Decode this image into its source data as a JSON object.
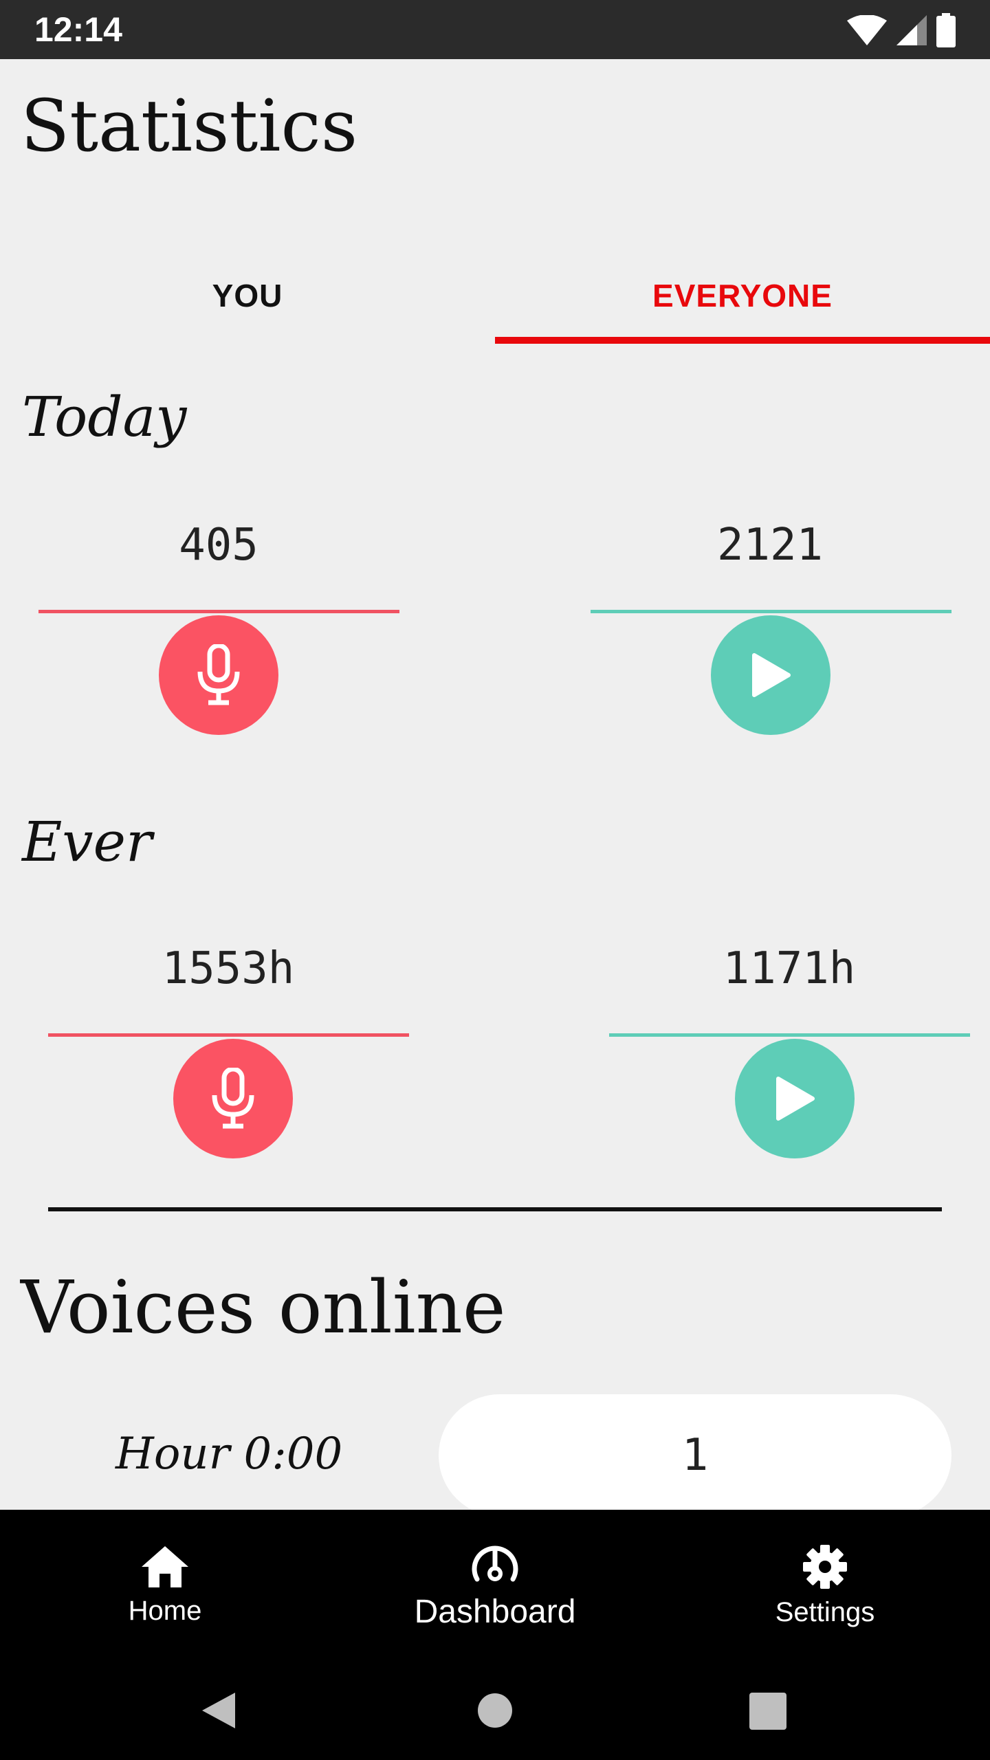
{
  "status_bar": {
    "time": "12:14"
  },
  "page": {
    "title": "Statistics"
  },
  "tabs": [
    {
      "label": "YOU",
      "selected": false
    },
    {
      "label": "EVERYONE",
      "selected": true
    }
  ],
  "today": {
    "label": "Today",
    "recorded": "405",
    "listened": "2121"
  },
  "ever": {
    "label": "Ever",
    "recorded": "1553h",
    "listened": "1171h"
  },
  "voices_online": {
    "title": "Voices online",
    "hour_label": "Hour 0:00",
    "count": "1"
  },
  "bottom_nav": {
    "items": [
      {
        "label": "Home",
        "icon": "home-icon"
      },
      {
        "label": "Dashboard",
        "icon": "dashboard-icon"
      },
      {
        "label": "Settings",
        "icon": "gear-icon"
      }
    ]
  },
  "colors": {
    "accent_red": "#e8080c",
    "record_red": "#fb5363",
    "listen_green": "#5ecdb7"
  }
}
